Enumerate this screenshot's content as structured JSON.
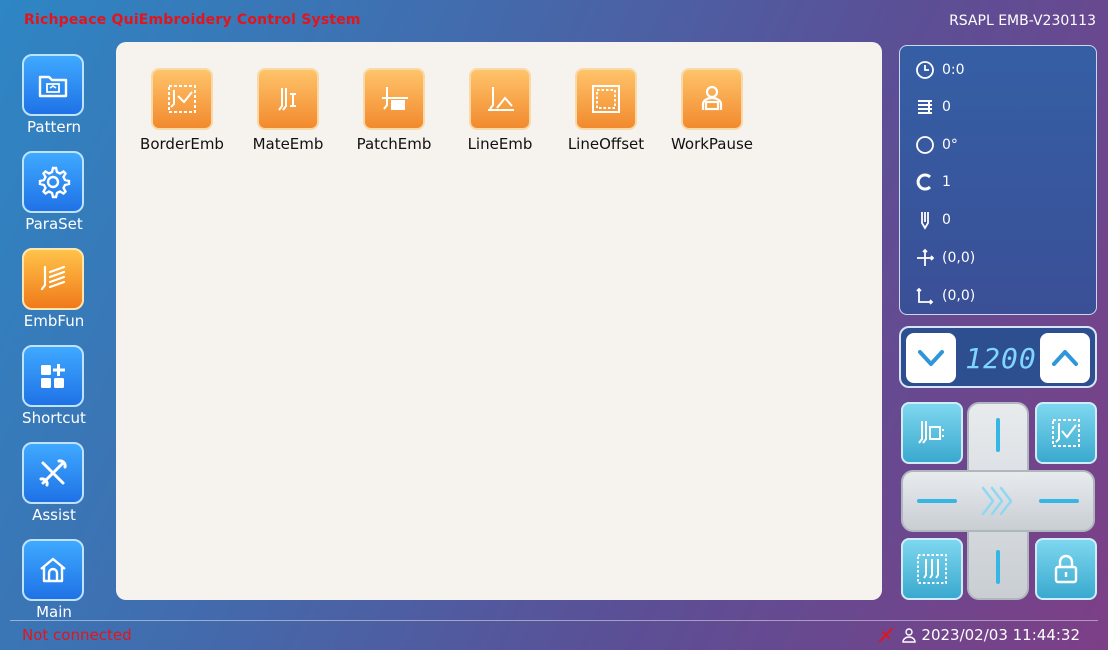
{
  "header": {
    "app_title": "Richpeace QuiEmbroidery Control System",
    "version": "RSAPL EMB-V230113"
  },
  "nav": {
    "items": [
      {
        "label": "Pattern",
        "icon": "folder-pattern-icon",
        "active": false
      },
      {
        "label": "ParaSet",
        "icon": "gear-icon",
        "active": false
      },
      {
        "label": "EmbFun",
        "icon": "embroidery-function-icon",
        "active": true
      },
      {
        "label": "Shortcut",
        "icon": "grid-plus-icon",
        "active": false
      },
      {
        "label": "Assist",
        "icon": "tools-icon",
        "active": false
      },
      {
        "label": "Main",
        "icon": "home-icon",
        "active": false
      }
    ]
  },
  "functions": {
    "items": [
      {
        "label": "BorderEmb",
        "icon": "border-emb-icon"
      },
      {
        "label": "MateEmb",
        "icon": "mate-emb-icon"
      },
      {
        "label": "PatchEmb",
        "icon": "patch-emb-icon"
      },
      {
        "label": "LineEmb",
        "icon": "line-emb-icon"
      },
      {
        "label": "LineOffset",
        "icon": "line-offset-icon"
      },
      {
        "label": "WorkPause",
        "icon": "work-pause-icon"
      }
    ]
  },
  "status": {
    "time": "0:0",
    "stitches": "0",
    "angle": "0°",
    "color": "1",
    "needle": "0",
    "position": "(0,0)",
    "origin": "(0,0)"
  },
  "speed": {
    "value": "1200"
  },
  "colors": {
    "accent_blue": "#1f72e6",
    "accent_orange": "#f28a2e",
    "teal": "#3aa9cf",
    "error_red": "#e3141b"
  },
  "footer": {
    "connection": "Not connected",
    "datetime": "2023/02/03 11:44:32"
  }
}
